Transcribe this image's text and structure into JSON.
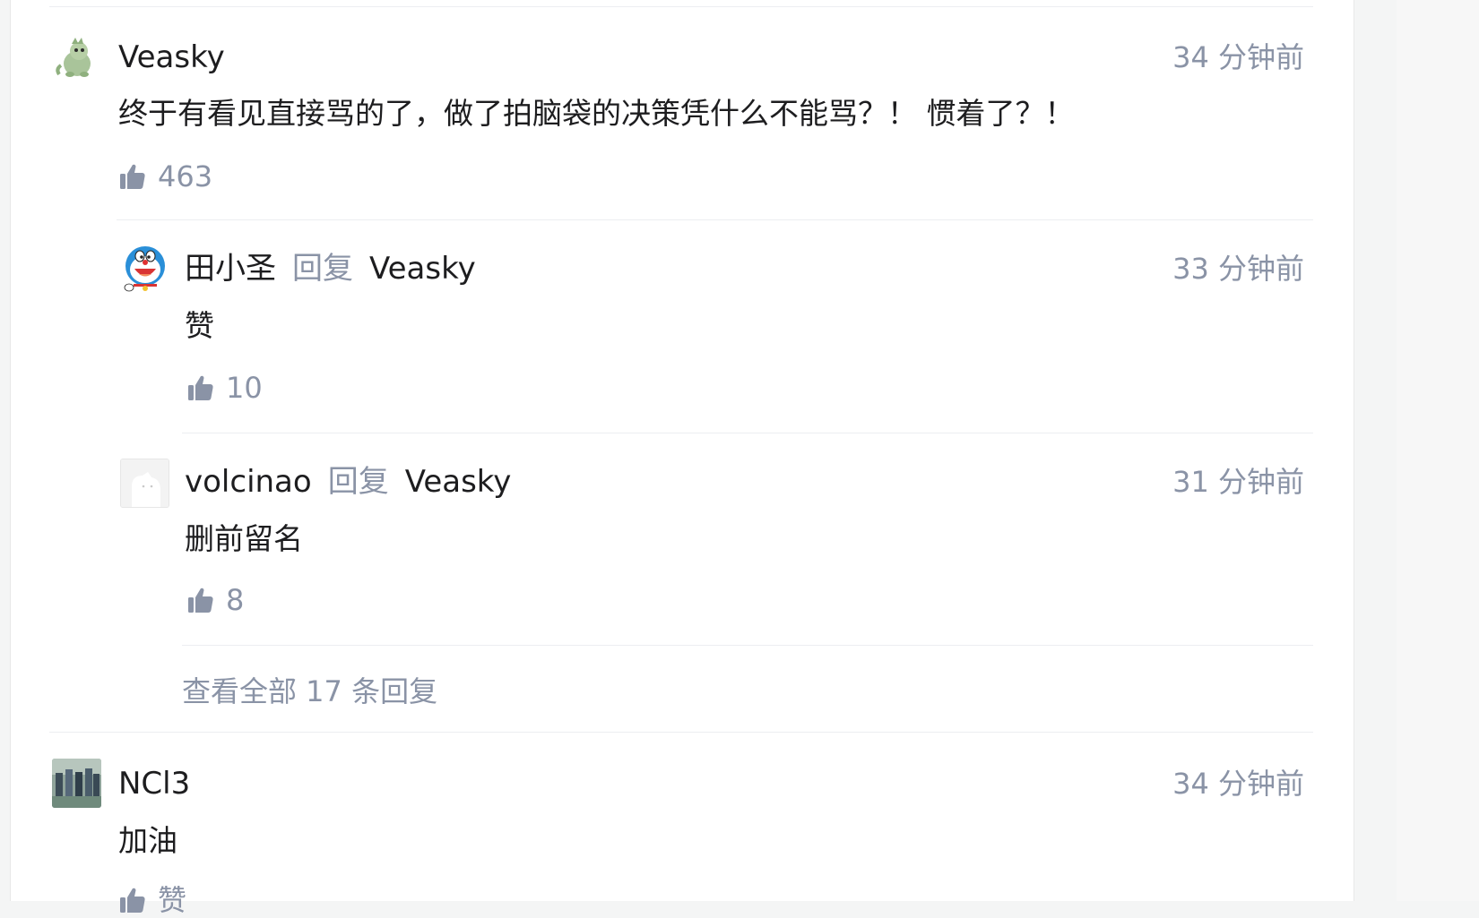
{
  "comments": [
    {
      "author": "Veasky",
      "time": "34 分钟前",
      "text": "终于有看见直接骂的了，做了拍脑袋的决策凭什么不能骂？！ 惯着了？！",
      "likes": "463",
      "avatar_icon": "dinosaur-avatar-icon"
    },
    {
      "author": "NCl3",
      "time": "34 分钟前",
      "text": "加油",
      "likes": "赞",
      "avatar_icon": "photo-avatar-icon"
    }
  ],
  "replies": [
    {
      "author": "田小圣",
      "reply_word": "回复",
      "reply_to": "Veasky",
      "time": "33 分钟前",
      "text": "赞",
      "likes": "10",
      "avatar_icon": "doraemon-avatar-icon"
    },
    {
      "author": "volcinao",
      "reply_word": "回复",
      "reply_to": "Veasky",
      "time": "31 分钟前",
      "text": "删前留名",
      "likes": "8",
      "avatar_icon": "default-avatar-icon"
    }
  ],
  "view_all_replies": "查看全部 17 条回复",
  "colors": {
    "text_primary": "#1d1d1f",
    "text_secondary": "#8a93a6",
    "divider": "#eceef1"
  }
}
